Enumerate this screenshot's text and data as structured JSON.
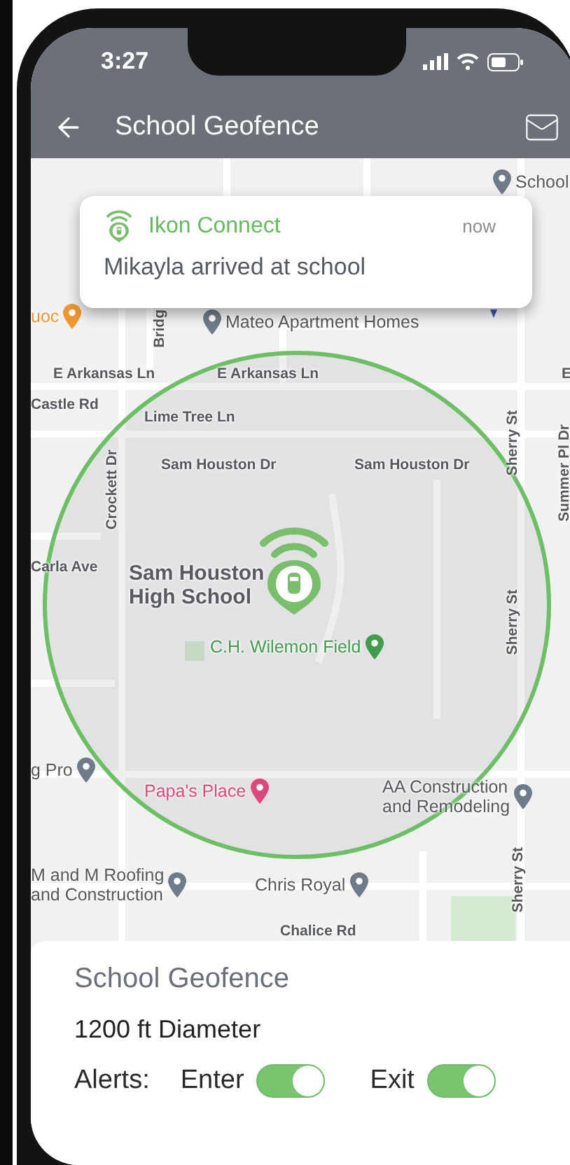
{
  "status_bar": {
    "time": "3:27"
  },
  "header": {
    "title": "School Geofence"
  },
  "notification": {
    "app": "Ikon Connect",
    "time": "now",
    "message": "Mikayla arrived at school"
  },
  "map": {
    "labels": [
      {
        "text": "School",
        "kind": "marker",
        "color": "#6e7b88"
      },
      {
        "text": "uoc",
        "kind": "poi",
        "color": "#ef962f"
      },
      {
        "text": "Bridg",
        "kind": "vroad"
      },
      {
        "text": "Mateo Apartment Homes",
        "kind": "marker",
        "color": "#6e7b88"
      },
      {
        "text": "E Arkansas Ln",
        "kind": "road"
      },
      {
        "text": "E Arkansas Ln",
        "kind": "road"
      },
      {
        "text": "E",
        "kind": "road"
      },
      {
        "text": "Castle Rd",
        "kind": "road"
      },
      {
        "text": "Lime Tree Ln",
        "kind": "road"
      },
      {
        "text": "Sam Houston Dr",
        "kind": "road"
      },
      {
        "text": "Sam Houston Dr",
        "kind": "road"
      },
      {
        "text": "Crockett Dr",
        "kind": "vroad"
      },
      {
        "text": "Sherry St",
        "kind": "vroad"
      },
      {
        "text": "Summer Pl Dr",
        "kind": "vroad"
      },
      {
        "text": "Carla Ave",
        "kind": "road"
      },
      {
        "text": "Sam Houston\nHigh School",
        "kind": "landmark"
      },
      {
        "text": "C.H. Wilemon Field",
        "kind": "poi",
        "color": "#3f9d4c"
      },
      {
        "text": "Sherry St",
        "kind": "vroad"
      },
      {
        "text": "g Pro",
        "kind": "poi",
        "color": "#6e7b88"
      },
      {
        "text": "Papa's Place",
        "kind": "poi",
        "color": "#e0457b"
      },
      {
        "text": "AA Construction\nand Remodeling",
        "kind": "poi",
        "color": "#6e7b88"
      },
      {
        "text": "M and M Roofing\nand Construction",
        "kind": "poi",
        "color": "#6e7b88"
      },
      {
        "text": "Chris Royal",
        "kind": "poi",
        "color": "#6e7b88"
      },
      {
        "text": "Sherry St",
        "kind": "vroad"
      },
      {
        "text": "Chalice Rd",
        "kind": "road"
      }
    ]
  },
  "geofence": {
    "name": "School Geofence",
    "diameter": "1200 ft Diameter",
    "alerts_label": "Alerts:",
    "toggles": [
      {
        "label": "Enter",
        "on": true
      },
      {
        "label": "Exit",
        "on": true
      }
    ]
  }
}
